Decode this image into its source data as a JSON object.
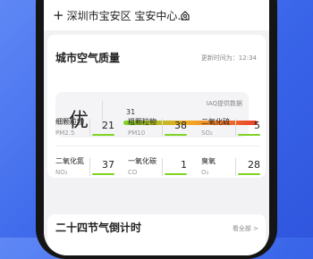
{
  "location": {
    "plus": "+",
    "text": "深圳市宝安区 宝安中心…",
    "icon": "location-pin-icon"
  },
  "air_card": {
    "title": "城市空气质量",
    "update_label": "更新时间为：12:34",
    "grade": "优",
    "aqi_value": "31",
    "source": "IAQ提供数据",
    "gradient_colors": [
      "#7ed321",
      "#f5a623",
      "#e8412c"
    ],
    "aqi_level_fraction": 0.05,
    "pollutants": [
      {
        "name": "细颗粒物",
        "code": "PM2.5",
        "value": "21"
      },
      {
        "name": "粗颗粒物",
        "code": "PM10",
        "value": "38"
      },
      {
        "name": "二氧化硫",
        "code": "SO₂",
        "value": "5"
      },
      {
        "name": "二氧化氮",
        "code": "NO₂",
        "value": "37"
      },
      {
        "name": "一氧化碳",
        "code": "CO",
        "value": "1"
      },
      {
        "name": "臭氧",
        "code": "O₃",
        "value": "28"
      }
    ]
  },
  "solar_card": {
    "title": "二十四节气倒计时",
    "more": "看全部 >"
  },
  "colors": {
    "background": "#3a66ea",
    "good": "#7ed321"
  }
}
